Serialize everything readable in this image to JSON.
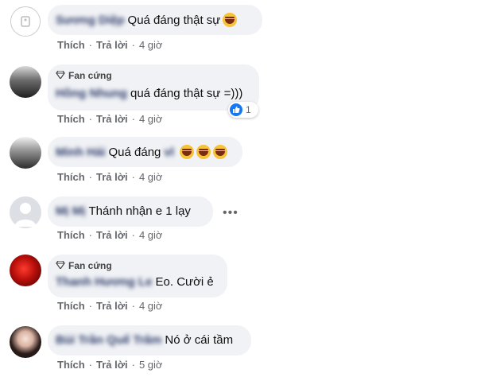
{
  "comments": [
    {
      "author": "Sương Diệp",
      "text": "Quá đáng thật sự",
      "emoji": [
        "rofl-emoji"
      ],
      "badge": "",
      "actions": {
        "like": "Thích",
        "reply": "Trả lời",
        "time": "4 giờ"
      }
    },
    {
      "author": "Hồng Nhung",
      "text": "quá đáng thật sự =)))",
      "badge": "Fan cứng",
      "reaction_count": "1",
      "actions": {
        "like": "Thích",
        "reply": "Trả lời",
        "time": "4 giờ"
      }
    },
    {
      "author": "Minh Hải",
      "text": "Quá đáng",
      "text_extra": "vl",
      "emoji": [
        "laugh-emoji",
        "laugh-emoji",
        "laugh-emoji"
      ],
      "badge": "",
      "actions": {
        "like": "Thích",
        "reply": "Trả lời",
        "time": "4 giờ"
      }
    },
    {
      "author": "Mị Mị",
      "text": "Thánh nhận e 1 lạy",
      "badge": "",
      "more": "•••",
      "actions": {
        "like": "Thích",
        "reply": "Trả lời",
        "time": "4 giờ"
      }
    },
    {
      "author": "Thanh Hương Le",
      "text": "Eo. Cười ẻ",
      "badge": "Fan cứng",
      "actions": {
        "like": "Thích",
        "reply": "Trả lời",
        "time": "4 giờ"
      }
    },
    {
      "author": "Bùi Trần Quế Trâm",
      "text": "Nó ở cái tầm",
      "badge": "",
      "actions": {
        "like": "Thích",
        "reply": "Trả lời",
        "time": "5 giờ"
      }
    }
  ],
  "colors": {
    "bubble": "#f0f2f5",
    "meta": "#65676b",
    "like_blue": "#1877f2"
  }
}
